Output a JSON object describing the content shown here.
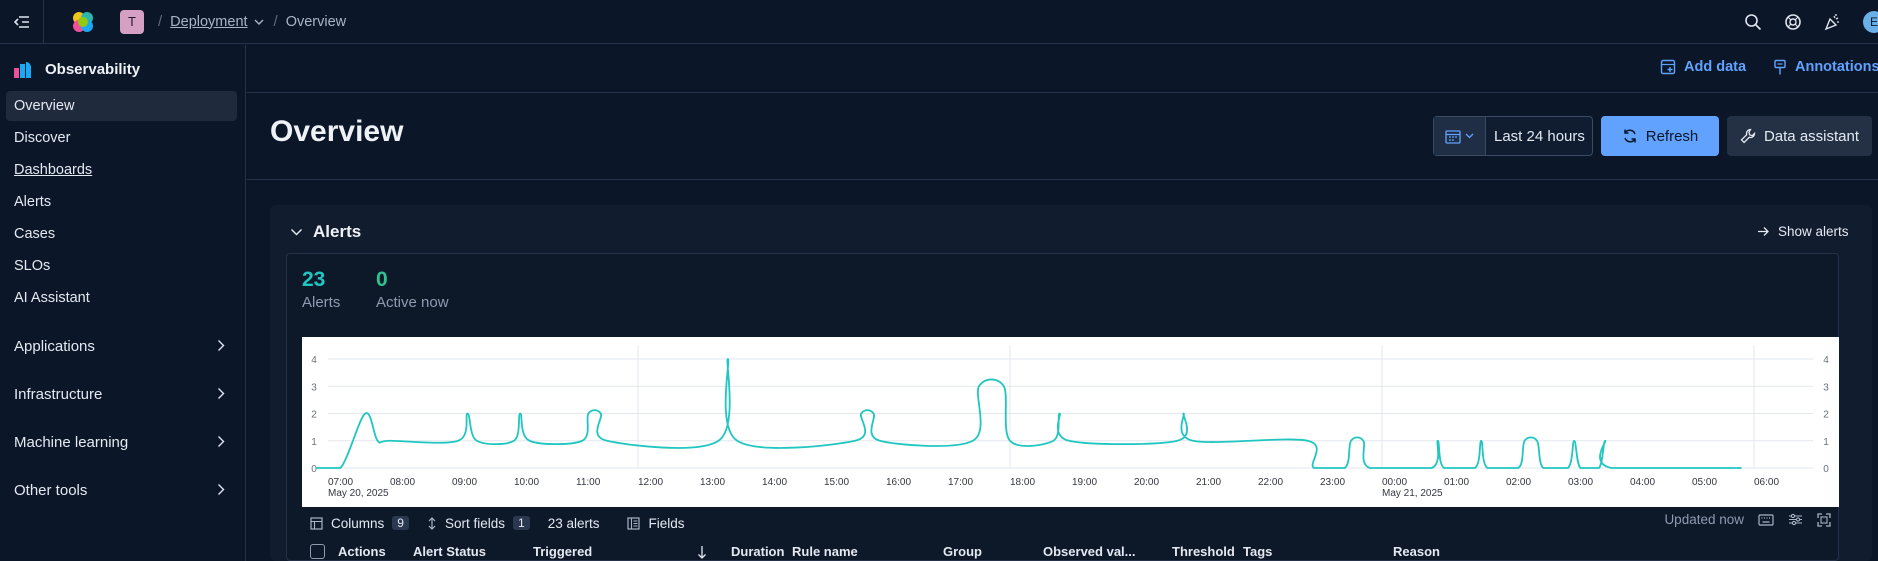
{
  "topbar": {
    "space_initial": "T",
    "breadcrumbs": {
      "deployment": "Deployment",
      "overview": "Overview"
    },
    "user_initial": "E"
  },
  "sidebar": {
    "title": "Observability",
    "items": [
      "Overview",
      "Discover",
      "Dashboards",
      "Alerts",
      "Cases",
      "SLOs",
      "AI Assistant"
    ],
    "groups": [
      "Applications",
      "Infrastructure",
      "Machine learning",
      "Other tools"
    ]
  },
  "header": {
    "add_data": "Add data",
    "annotations": "Annotations",
    "title": "Overview",
    "date_range": "Last 24 hours",
    "refresh": "Refresh",
    "data_assistant": "Data assistant"
  },
  "alerts": {
    "section_title": "Alerts",
    "show_alerts": "Show alerts",
    "total_value": "23",
    "total_label": "Alerts",
    "active_value": "0",
    "active_label": "Active now"
  },
  "colors": {
    "accent": "#61a2ff",
    "series": "#20c6c0",
    "stat_total": "#20c6c0",
    "stat_active": "#2ec28e"
  },
  "toolbar": {
    "columns": "Columns",
    "columns_count": "9",
    "sort": "Sort fields",
    "sort_count": "1",
    "alerts_count": "23 alerts",
    "fields": "Fields",
    "updated": "Updated now"
  },
  "table": {
    "columns": [
      "Actions",
      "Alert Status",
      "Triggered",
      "Duration",
      "Rule name",
      "Group",
      "Observed val...",
      "Threshold",
      "Tags",
      "Reason"
    ]
  },
  "chart_data": {
    "type": "line",
    "y_ticks": [
      0,
      1,
      2,
      3,
      4
    ],
    "ylim": [
      0,
      4
    ],
    "x_ticks": [
      "07:00",
      "08:00",
      "09:00",
      "10:00",
      "11:00",
      "12:00",
      "13:00",
      "14:00",
      "15:00",
      "16:00",
      "17:00",
      "18:00",
      "19:00",
      "20:00",
      "21:00",
      "22:00",
      "23:00",
      "00:00",
      "01:00",
      "02:00",
      "03:00",
      "04:00",
      "05:00",
      "06:00"
    ],
    "date_labels": [
      {
        "at": "07:00",
        "text": "May 20, 2025"
      },
      {
        "at": "00:00",
        "text": "May 21, 2025"
      }
    ],
    "grid": true,
    "series": [
      {
        "x": [
          6.8,
          7.2,
          7.6,
          7.8,
          8.0,
          9.1,
          9.25,
          9.4,
          10.0,
          10.1,
          10.25,
          11.1,
          11.2,
          11.4,
          11.5,
          13.3,
          13.45,
          13.6,
          15.5,
          15.6,
          15.8,
          15.9,
          17.4,
          17.5,
          17.9,
          18.0,
          18.7,
          18.8,
          18.95,
          20.7,
          20.8,
          20.95,
          22.8,
          22.9,
          23.4,
          23.5,
          23.7,
          23.8,
          24.8,
          24.9,
          25.0,
          25.5,
          25.6,
          25.7,
          26.2,
          26.3,
          26.5,
          26.6,
          27.0,
          27.1,
          27.2,
          27.5,
          27.6,
          27.7,
          29.8
        ],
        "y": [
          0,
          0,
          2,
          1,
          1,
          1,
          2,
          1,
          1,
          2,
          1,
          1,
          2,
          2,
          1,
          1,
          4,
          1,
          1,
          2,
          2,
          1,
          1,
          3,
          3,
          1,
          1,
          2,
          1,
          1,
          2,
          1,
          1,
          0,
          0,
          1,
          1,
          0,
          0,
          1,
          0,
          0,
          1,
          0,
          0,
          1,
          1,
          0,
          0,
          1,
          0,
          0,
          1,
          0,
          0
        ]
      }
    ]
  }
}
